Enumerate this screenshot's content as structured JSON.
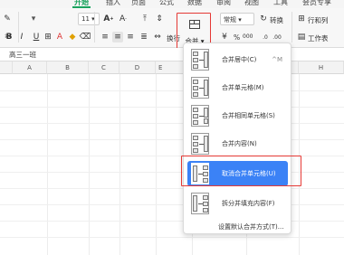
{
  "ribbon_tabs": [
    {
      "label": "开始",
      "active": true
    },
    {
      "label": "插入",
      "active": false
    },
    {
      "label": "页面",
      "active": false
    },
    {
      "label": "公式",
      "active": false
    },
    {
      "label": "数据",
      "active": false
    },
    {
      "label": "审阅",
      "active": false
    },
    {
      "label": "视图",
      "active": false
    },
    {
      "label": "工具",
      "active": false
    },
    {
      "label": "会员专享",
      "active": false
    }
  ],
  "ribbon": {
    "font_size_value": "11",
    "wrap_label": "换行",
    "merge_label": "合并",
    "number_format_value": "常规",
    "convert_label": "转换",
    "rows_cols_label": "行和列",
    "sheet_label": "工作表",
    "percent_label": "%",
    "decimal_label": "000"
  },
  "formula_bar": {
    "content": "高三一班"
  },
  "columns": [
    "A",
    "B",
    "C",
    "D",
    "E",
    "F",
    "G",
    "H"
  ],
  "merge_menu": {
    "items": [
      {
        "label": "合并居中(C)",
        "shortcut": "^M",
        "selected": false
      },
      {
        "label": "合并单元格(M)",
        "shortcut": "",
        "selected": false
      },
      {
        "label": "合并相同单元格(S)",
        "shortcut": "",
        "selected": false
      },
      {
        "label": "合并内容(N)",
        "shortcut": "",
        "selected": false
      },
      {
        "label": "取消合并单元格(U)",
        "shortcut": "",
        "selected": true
      },
      {
        "label": "拆分并填充内容(F)",
        "shortcut": "",
        "selected": false
      }
    ],
    "footer": "设置默认合并方式(T)..."
  },
  "colors": {
    "accent": "#1aa35e",
    "highlight": "#3b82f6",
    "annotation_red": "#e53935"
  }
}
